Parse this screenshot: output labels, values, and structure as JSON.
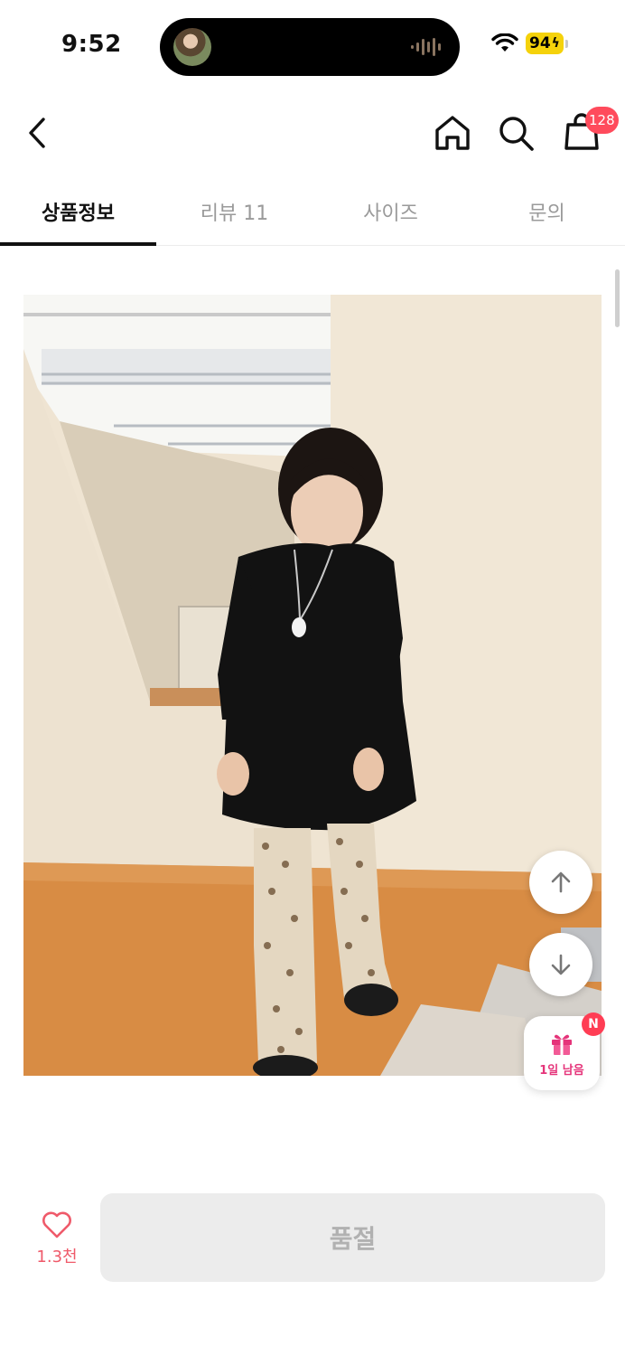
{
  "status_bar": {
    "time": "9:52",
    "battery": "94",
    "battery_color": "#f5d20b"
  },
  "nav": {
    "back_icon": "chevron-left-icon",
    "home_icon": "home-icon",
    "search_icon": "search-icon",
    "cart_icon": "shopping-bag-icon",
    "cart_count": "128",
    "badge_color": "#ff4b5c"
  },
  "tabs": [
    {
      "label": "상품정보",
      "active": true
    },
    {
      "label": "리뷰 11",
      "active": false
    },
    {
      "label": "사이즈",
      "active": false
    },
    {
      "label": "문의",
      "active": false
    }
  ],
  "floating": {
    "up_icon": "arrow-up-icon",
    "down_icon": "arrow-down-icon",
    "gift_icon": "gift-icon",
    "gift_label": "1일 남음",
    "gift_badge": "N",
    "gift_color": "#e5347a"
  },
  "bottom": {
    "like_icon": "heart-icon",
    "like_count": "1.3천",
    "soldout_label": "품절",
    "accent": "#ef5a6a"
  }
}
